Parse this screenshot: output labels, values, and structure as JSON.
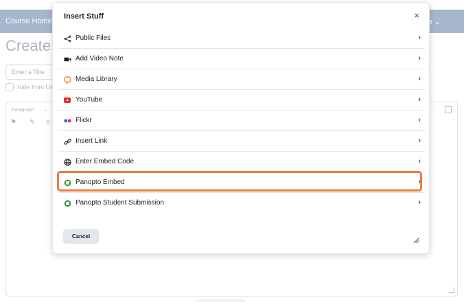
{
  "background": {
    "nav": {
      "course_home": "Course Home",
      "more_label": "e"
    },
    "page_title": "Create a",
    "title_placeholder": "Enter a Title",
    "hide_label": "Hide from Use",
    "editor": {
      "paragraph_label": "Paragraph"
    }
  },
  "dialog": {
    "title": "Insert Stuff",
    "close_label": "×",
    "items": [
      {
        "label": "Public Files",
        "icon": "share-icon"
      },
      {
        "label": "Add Video Note",
        "icon": "video-camera-icon"
      },
      {
        "label": "Media Library",
        "icon": "media-library-icon"
      },
      {
        "label": "YouTube",
        "icon": "youtube-icon"
      },
      {
        "label": "Flickr",
        "icon": "flickr-icon"
      },
      {
        "label": "Insert Link",
        "icon": "link-icon"
      },
      {
        "label": "Enter Embed Code",
        "icon": "globe-icon"
      },
      {
        "label": "Panopto Embed",
        "icon": "panopto-icon"
      },
      {
        "label": "Panopto Student Submission",
        "icon": "panopto-icon"
      }
    ],
    "chevron": "›",
    "cancel_label": "Cancel",
    "highlighted_item": "Panopto Embed",
    "colors": {
      "highlight": "#e87d3e",
      "youtube": "#e52d27",
      "panopto": "#3d9a48",
      "media_library": "#f08a24"
    }
  }
}
